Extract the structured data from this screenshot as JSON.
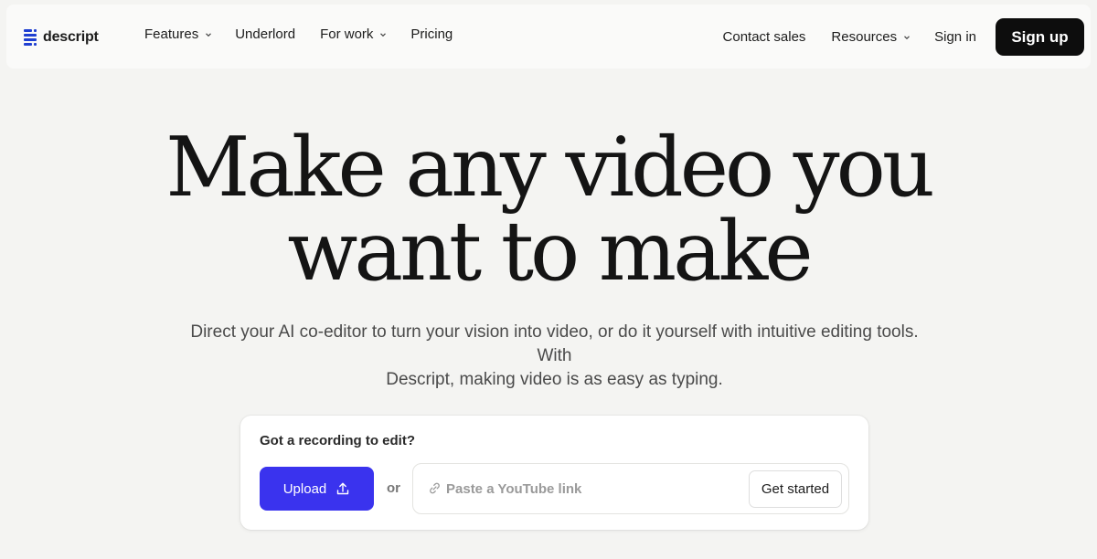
{
  "brand": {
    "name": "descript",
    "accent": "#3a33ee"
  },
  "nav": {
    "left_links": [
      {
        "label": "Features",
        "has_dropdown": true
      },
      {
        "label": "Underlord",
        "has_dropdown": false
      },
      {
        "label": "For work",
        "has_dropdown": true
      },
      {
        "label": "Pricing",
        "has_dropdown": false
      }
    ],
    "right_links": [
      {
        "label": "Contact sales",
        "has_dropdown": false
      },
      {
        "label": "Resources",
        "has_dropdown": true
      },
      {
        "label": "Sign in",
        "has_dropdown": false
      }
    ],
    "cta_label": "Sign up"
  },
  "hero": {
    "title_lines": [
      "Make any video you",
      "want to make"
    ],
    "subtitle_lines": [
      "Direct your AI co-editor to turn your vision into video, or do it yourself with intuitive editing tools. With",
      "Descript, making video is as easy as typing."
    ]
  },
  "upload_card": {
    "label": "Got a recording to edit?",
    "upload_label": "Upload",
    "upload_icon": "upload-icon",
    "or_label": "or",
    "link_icon": "link-icon",
    "link_placeholder": "Paste a YouTube link",
    "link_value": "",
    "submit_label": "Get started"
  }
}
